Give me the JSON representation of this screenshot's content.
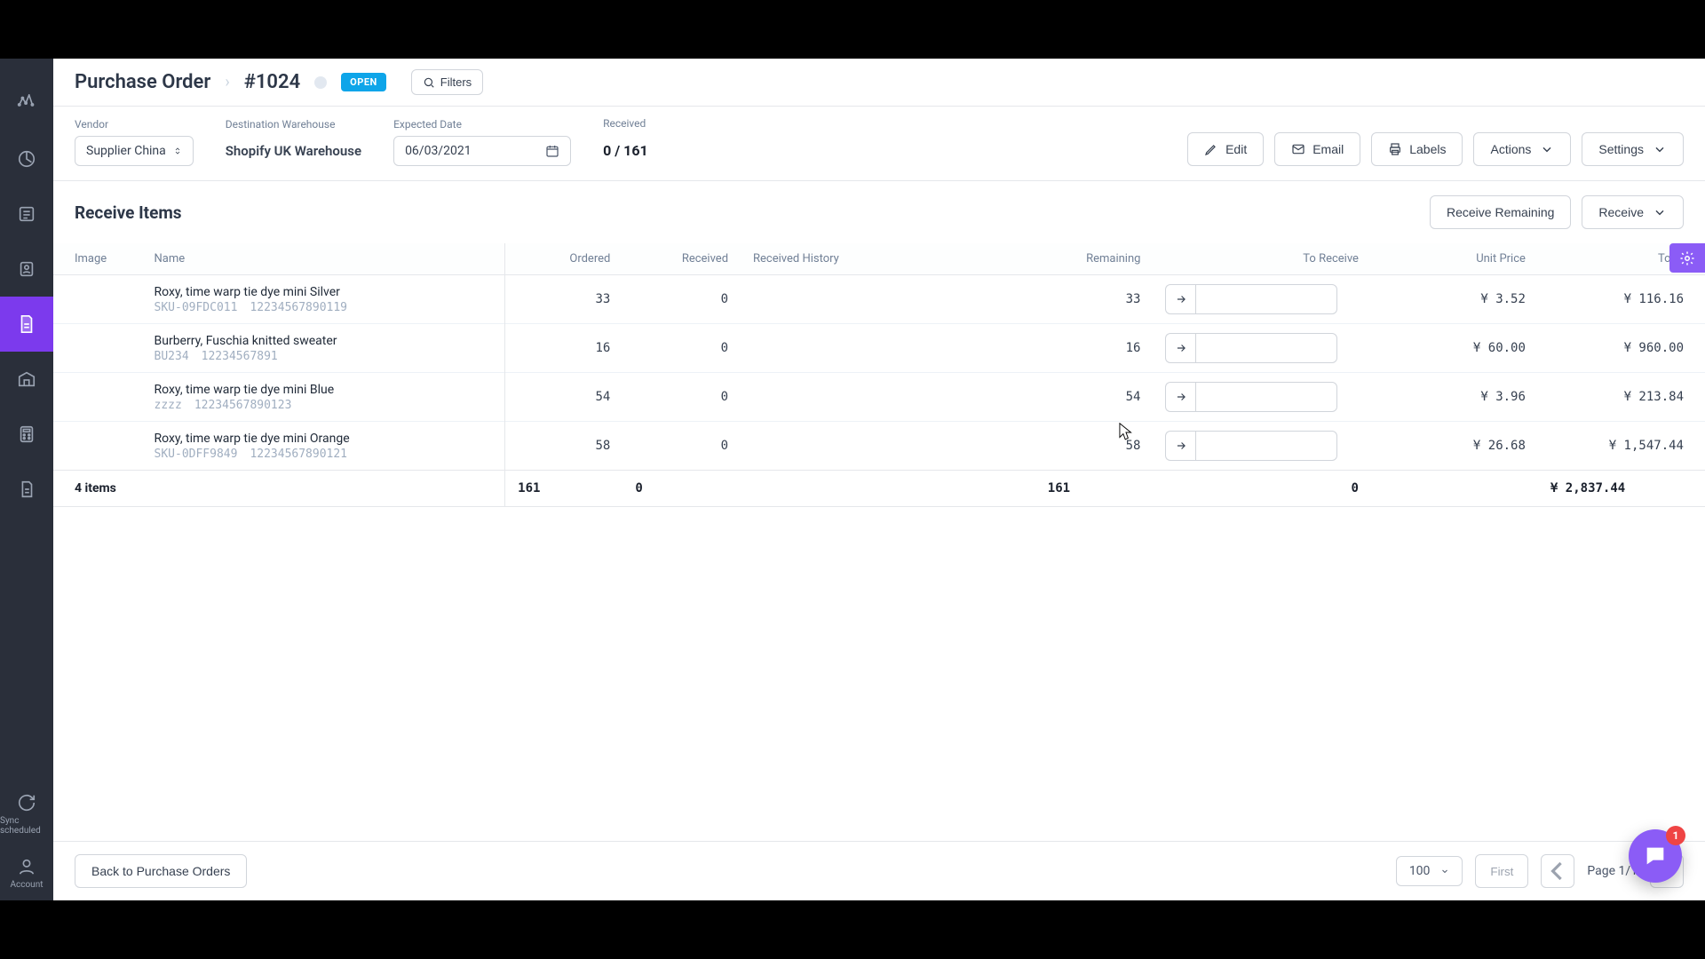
{
  "breadcrumb": {
    "title": "Purchase Order",
    "id": "#1024"
  },
  "status": {
    "label": "OPEN"
  },
  "filters_label": "Filters",
  "fields": {
    "vendor_label": "Vendor",
    "vendor_value": "Supplier China",
    "dest_label": "Destination Warehouse",
    "dest_value": "Shopify UK Warehouse",
    "date_label": "Expected Date",
    "date_value": "06/03/2021",
    "received_label": "Received",
    "received_value": "0 / 161"
  },
  "buttons": {
    "edit": "Edit",
    "email": "Email",
    "labels": "Labels",
    "actions": "Actions",
    "settings": "Settings",
    "receive_remaining": "Receive Remaining",
    "receive": "Receive",
    "back": "Back to Purchase Orders",
    "first": "First"
  },
  "section_title": "Receive Items",
  "columns": {
    "image": "Image",
    "name": "Name",
    "ordered": "Ordered",
    "received": "Received",
    "history": "Received History",
    "remaining": "Remaining",
    "to_receive": "To Receive",
    "unit_price": "Unit Price",
    "total": "Total"
  },
  "rows": [
    {
      "name": "Roxy, time warp tie dye mini Silver",
      "sku": "SKU-09FDC011",
      "barcode": "12234567890119",
      "ordered": "33",
      "received": "0",
      "remaining": "33",
      "unit_price": "¥ 3.52",
      "total": "¥ 116.16"
    },
    {
      "name": "Burberry, Fuschia knitted sweater",
      "sku": "BU234",
      "barcode": "12234567891",
      "ordered": "16",
      "received": "0",
      "remaining": "16",
      "unit_price": "¥ 60.00",
      "total": "¥ 960.00"
    },
    {
      "name": "Roxy, time warp tie dye mini Blue",
      "sku": "zzzz",
      "barcode": "12234567890123",
      "ordered": "54",
      "received": "0",
      "remaining": "54",
      "unit_price": "¥ 3.96",
      "total": "¥ 213.84"
    },
    {
      "name": "Roxy, time warp tie dye mini Orange",
      "sku": "SKU-0DFF9849",
      "barcode": "12234567890121",
      "ordered": "58",
      "received": "0",
      "remaining": "58",
      "unit_price": "¥ 26.68",
      "total": "¥ 1,547.44"
    }
  ],
  "footer": {
    "items_label": "4 items",
    "ordered": "161",
    "received": "0",
    "remaining": "161",
    "to_receive": "0",
    "total": "¥ 2,837.44"
  },
  "pager": {
    "page_size": "100",
    "page_label": "Page 1/1"
  },
  "sidebar": {
    "sync_label": "Sync scheduled",
    "account_label": "Account"
  },
  "chat_badge": "1"
}
